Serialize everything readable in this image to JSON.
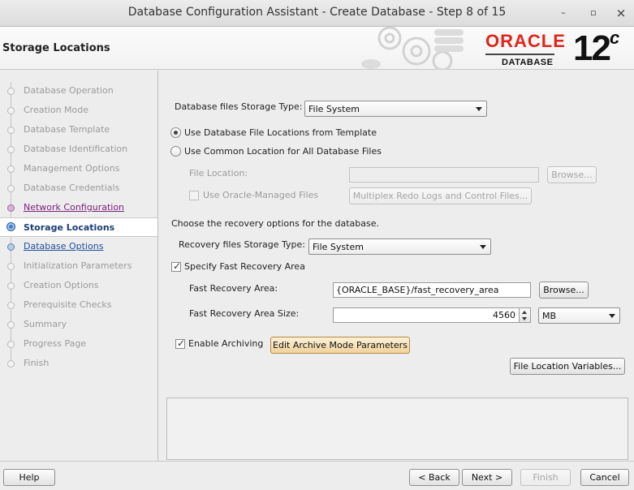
{
  "window": {
    "title": "Database Configuration Assistant - Create Database - Step 8 of 15",
    "minimize_glyph": "–",
    "maximize_glyph": "▫",
    "close_glyph": "×"
  },
  "header": {
    "page_title": "Storage Locations",
    "brand": "ORACLE",
    "brand_sub": "DATABASE",
    "version": "12",
    "version_suffix": "c"
  },
  "nav": {
    "items": [
      {
        "label": "Database Operation",
        "state": "disabled"
      },
      {
        "label": "Creation Mode",
        "state": "disabled"
      },
      {
        "label": "Database Template",
        "state": "disabled"
      },
      {
        "label": "Database Identification",
        "state": "disabled"
      },
      {
        "label": "Management Options",
        "state": "disabled"
      },
      {
        "label": "Database Credentials",
        "state": "disabled"
      },
      {
        "label": "Network Configuration",
        "state": "visited"
      },
      {
        "label": "Storage Locations",
        "state": "current"
      },
      {
        "label": "Database Options",
        "state": "link"
      },
      {
        "label": "Initialization Parameters",
        "state": "disabled"
      },
      {
        "label": "Creation Options",
        "state": "disabled"
      },
      {
        "label": "Prerequisite Checks",
        "state": "disabled"
      },
      {
        "label": "Summary",
        "state": "disabled"
      },
      {
        "label": "Progress Page",
        "state": "disabled"
      },
      {
        "label": "Finish",
        "state": "disabled"
      }
    ]
  },
  "main": {
    "storage_type_label": "Database files Storage Type:",
    "storage_type_value": "File System",
    "radio_template": "Use Database File Locations from Template",
    "radio_common": "Use Common Location for All Database Files",
    "file_location_label": "File Location:",
    "file_location_value": "",
    "browse_label": "Browse...",
    "use_omf_label": "Use Oracle-Managed Files",
    "multiplex_button": "Multiplex Redo Logs and Control Files...",
    "recovery_intro": "Choose the recovery options for the database.",
    "recovery_type_label": "Recovery files Storage Type:",
    "recovery_type_value": "File System",
    "specify_fra_label": "Specify Fast Recovery Area",
    "fra_label": "Fast Recovery Area:",
    "fra_value": "{ORACLE_BASE}/fast_recovery_area",
    "fra_browse_label": "Browse...",
    "fra_size_label": "Fast Recovery Area Size:",
    "fra_size_value": "4560",
    "fra_size_unit": "MB",
    "enable_archiving_label": "Enable Archiving",
    "edit_archive_button": "Edit Archive Mode Parameters",
    "file_location_vars_button": "File Location Variables..."
  },
  "footer": {
    "help": "Help",
    "back": "< Back",
    "next": "Next >",
    "finish": "Finish",
    "cancel": "Cancel"
  }
}
